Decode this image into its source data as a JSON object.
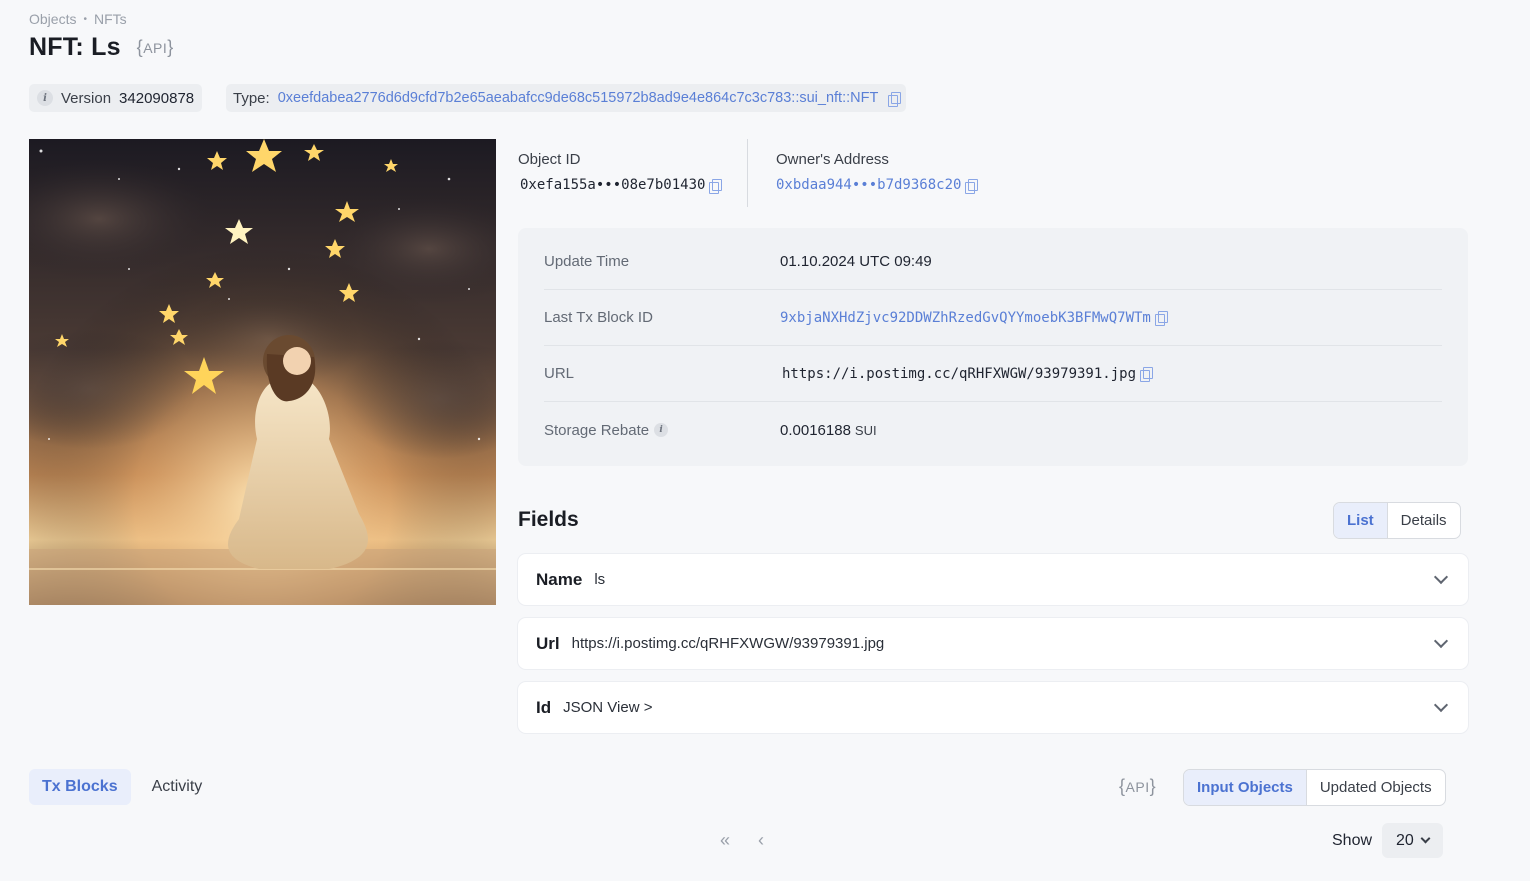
{
  "breadcrumb": [
    "Objects",
    "NFTs"
  ],
  "breadcrumb_sep": "•",
  "title": "NFT: Ls",
  "api_badge": {
    "open": "{",
    "label": "API",
    "close": "}"
  },
  "version": {
    "label": "Version",
    "value": "342090878"
  },
  "type": {
    "label": "Type:",
    "value": "0xeefdabea2776d6d9cfd7b2e65aeabafcc9de68c515972b8ad9e4e864c7c3c783::sui_nft::NFT"
  },
  "object_id": {
    "label": "Object ID",
    "value": "0xefa155a•••08e7b01430"
  },
  "owner": {
    "label": "Owner's Address",
    "value": "0xbdaa944•••b7d9368c20"
  },
  "properties": [
    {
      "key": "Update Time",
      "value": "01.10.2024 UTC 09:49"
    },
    {
      "key": "Last Tx Block ID",
      "value": "9xbjaNXHdZjvc92DDWZhRzedGvQYYmoebK3BFMwQ7WTm"
    },
    {
      "key": "URL",
      "value": "https://i.postimg.cc/qRHFXWGW/93979391.jpg"
    },
    {
      "key": "Storage Rebate",
      "value": "0.0016188",
      "unit": "SUI"
    }
  ],
  "fields": {
    "title": "Fields",
    "view_tabs": [
      "List",
      "Details"
    ],
    "items": [
      {
        "name": "Name",
        "value": "ls"
      },
      {
        "name": "Url",
        "value": "https://i.postimg.cc/qRHFXWGW/93979391.jpg"
      },
      {
        "name": "Id",
        "value": "JSON View >"
      }
    ]
  },
  "bottom_tabs": [
    "Tx Blocks",
    "Activity"
  ],
  "object_tabs": [
    "Input Objects",
    "Updated Objects"
  ],
  "pager": {
    "first": "«",
    "prev": "‹"
  },
  "show": {
    "label": "Show",
    "value": "20"
  },
  "colors": {
    "accent": "#4b72d1",
    "link": "#5a7fd6",
    "bg": "#f7f8fa"
  }
}
